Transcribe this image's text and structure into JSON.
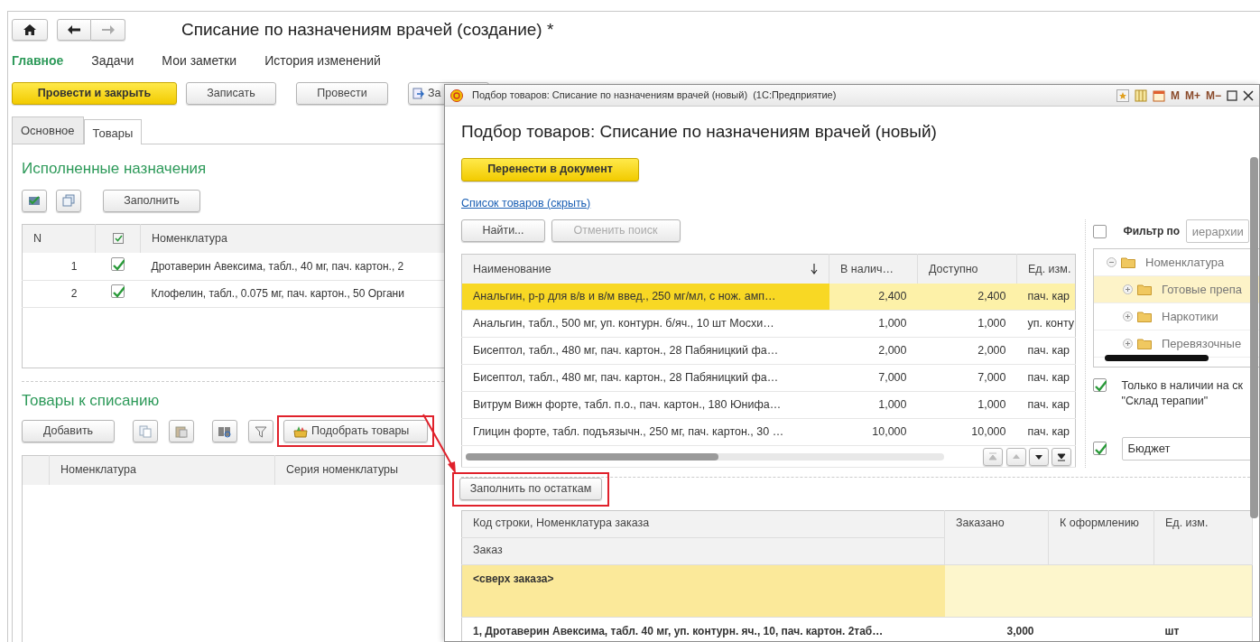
{
  "window": {
    "title": "Списание по назначениям врачей (создание) *"
  },
  "menu": [
    {
      "label": "Главное",
      "selected": true
    },
    {
      "label": "Задачи",
      "selected": false
    },
    {
      "label": "Мои заметки",
      "selected": false
    },
    {
      "label": "История изменений",
      "selected": false
    }
  ],
  "command_bar": [
    {
      "label": "Провести и закрыть",
      "kind": "primary"
    },
    {
      "label": "Записать",
      "kind": "default"
    },
    {
      "label": "Провести",
      "kind": "default"
    },
    {
      "label": "За",
      "kind": "icon_text"
    }
  ],
  "tabs": [
    {
      "label": "Основное",
      "selected": false
    },
    {
      "label": "Товары",
      "selected": true
    }
  ],
  "executed": {
    "title": "Исполненные назначения",
    "fill_button": "Заполнить",
    "columns": [
      "N",
      "Номенклатура"
    ],
    "rows": [
      {
        "n": "1",
        "checked": true,
        "name": "Дротаверин Авексима, табл., 40 мг, пач. картон., 2"
      },
      {
        "n": "2",
        "checked": true,
        "name": "Клофелин, табл., 0.075 мг, пач. картон., 50  Органи"
      }
    ]
  },
  "writeoff": {
    "title": "Товары к списанию",
    "add_button": "Добавить",
    "pick_button": {
      "label": "Подобрать товары",
      "highlighted": true
    },
    "columns": [
      "Номенклатура",
      "Серия номенклатуры"
    ]
  },
  "dialog": {
    "window_title": "Подбор товаров: Списание по назначениям врачей (новый)  (1С:Предприятие)",
    "title_buttons": [
      "M",
      "M+",
      "M−"
    ],
    "heading": "Подбор товаров: Списание по назначениям врачей (новый)",
    "transfer_button": "Перенести в документ",
    "list_link": "Список товаров (скрыть)",
    "find_button": "Найти...",
    "cancel_search": {
      "label": "Отменить поиск",
      "disabled": true
    },
    "filter": {
      "checked": false,
      "label": "Фильтр по",
      "value": "иерархии"
    },
    "goods": {
      "columns": [
        {
          "label": "Наименование",
          "sorted": true
        },
        {
          "label": "В налич…",
          "sorted": false
        },
        {
          "label": "Доступно",
          "sorted": false
        },
        {
          "label": "Ед. изм.",
          "sorted": false
        }
      ],
      "rows": [
        {
          "name": "Анальгин, р-р для в/в и в/м введ., 250 мг/мл, с нож. амп…",
          "in_stock": "2,400",
          "available": "2,400",
          "unit": "пач. кар",
          "selected": true
        },
        {
          "name": "Анальгин, табл., 500 мг, уп. контурн. б/яч., 10 шт Мосхи…",
          "in_stock": "1,000",
          "available": "1,000",
          "unit": "уп. конту",
          "selected": false
        },
        {
          "name": "Бисептол, табл., 480 мг, пач. картон., 28  Пабяницкий фа…",
          "in_stock": "2,000",
          "available": "2,000",
          "unit": "пач. кар",
          "selected": false
        },
        {
          "name": "Бисептол, табл., 480 мг, пач. картон., 28  Пабяницкий фа…",
          "in_stock": "7,000",
          "available": "7,000",
          "unit": "пач. кар",
          "selected": false
        },
        {
          "name": "Витрум Вижн форте, табл. п.о., пач. картон., 180  Юнифа…",
          "in_stock": "1,000",
          "available": "1,000",
          "unit": "пач. кар",
          "selected": false
        },
        {
          "name": "Глицин форте, табл. подъязычн., 250 мг, пач. картон., 30 …",
          "in_stock": "10,000",
          "available": "10,000",
          "unit": "пач. кар",
          "selected": false
        }
      ]
    },
    "tree": [
      {
        "label": "Номенклатура",
        "expanded": true,
        "selected": false,
        "children": [
          {
            "label": "Готовые препа",
            "expanded": false,
            "selected": true
          },
          {
            "label": "Наркотики",
            "expanded": false,
            "selected": false
          },
          {
            "label": "Перевязочные",
            "expanded": false,
            "selected": false
          }
        ]
      }
    ],
    "in_stock_only": {
      "checked": true,
      "lines": [
        "Только в наличии на ск",
        "\"Склад терапии\""
      ]
    },
    "budget": {
      "checked": true,
      "value": "Бюджет"
    },
    "fill_by_stock": {
      "label": "Заполнить по остаткам",
      "highlighted": true
    },
    "orders": {
      "columns": {
        "line": "Код строки, Номенклатура заказа",
        "order": "Заказ",
        "ordered": "Заказано",
        "to_issue": "К оформлению",
        "unit": "Ед. изм."
      },
      "rows": [
        {
          "kind": "group",
          "label": "<сверх заказа>"
        },
        {
          "kind": "item",
          "label": "1, Дротаверин Авексима, табл. 40 мг, уп. контурн. яч., 10, пач. картон. 2таб…",
          "ordered": "3,000",
          "unit": "шт"
        }
      ]
    }
  }
}
